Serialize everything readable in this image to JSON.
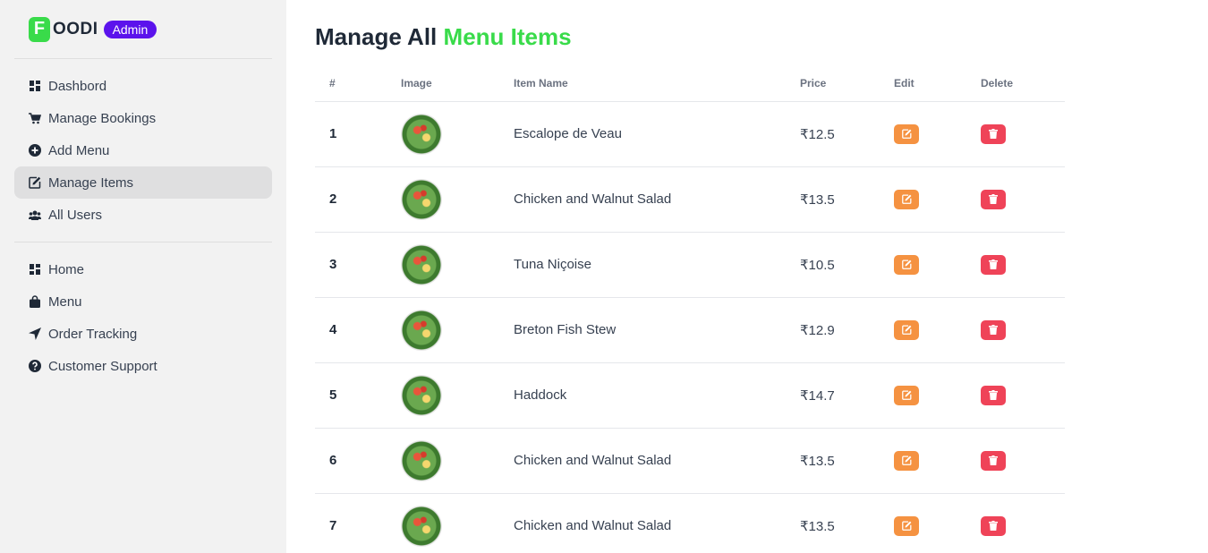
{
  "brand": {
    "logo_letter": "F",
    "logo_rest": "OODI",
    "badge": "Admin"
  },
  "sidebar": {
    "primary": [
      {
        "label": "Dashbord",
        "icon": "dashboard-icon"
      },
      {
        "label": "Manage Bookings",
        "icon": "cart-icon"
      },
      {
        "label": "Add Menu",
        "icon": "plus-circle-icon"
      },
      {
        "label": "Manage Items",
        "icon": "edit-icon",
        "active": true
      },
      {
        "label": "All Users",
        "icon": "users-icon"
      }
    ],
    "secondary": [
      {
        "label": "Home",
        "icon": "dashboard-icon"
      },
      {
        "label": "Menu",
        "icon": "bag-icon"
      },
      {
        "label": "Order Tracking",
        "icon": "location-arrow-icon"
      },
      {
        "label": "Customer Support",
        "icon": "question-circle-icon"
      }
    ]
  },
  "page": {
    "title_prefix": "Manage All",
    "title_accent": "Menu Items"
  },
  "table": {
    "headers": [
      "#",
      "Image",
      "Item Name",
      "Price",
      "Edit",
      "Delete"
    ],
    "rows": [
      {
        "num": "1",
        "name": "Escalope de Veau",
        "price": "₹12.5"
      },
      {
        "num": "2",
        "name": "Chicken and Walnut Salad",
        "price": "₹13.5"
      },
      {
        "num": "3",
        "name": "Tuna Niçoise",
        "price": "₹10.5"
      },
      {
        "num": "4",
        "name": "Breton Fish Stew",
        "price": "₹12.9"
      },
      {
        "num": "5",
        "name": "Haddock",
        "price": "₹14.7"
      },
      {
        "num": "6",
        "name": "Chicken and Walnut Salad",
        "price": "₹13.5"
      },
      {
        "num": "7",
        "name": "Chicken and Walnut Salad",
        "price": "₹13.5"
      }
    ]
  },
  "colors": {
    "accent": "#39db4a",
    "badge": "#5b13ec",
    "edit": "#f59241",
    "delete": "#ef4358"
  }
}
